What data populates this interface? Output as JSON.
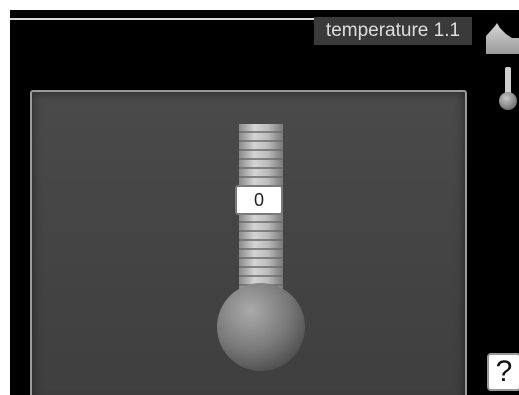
{
  "header": {
    "title": "temperature 1.1",
    "icons": [
      "home-icon",
      "thermometer-icon"
    ]
  },
  "thermometer": {
    "value": "0",
    "icon": "thermometer-icon"
  },
  "help": {
    "label": "?",
    "icon": "help-icon"
  },
  "colors": {
    "screen_background": "#000000",
    "panel_background": "#444444",
    "panel_border": "#9a9a9a",
    "title_background": "#3a3a3a",
    "title_text": "#dedede"
  }
}
